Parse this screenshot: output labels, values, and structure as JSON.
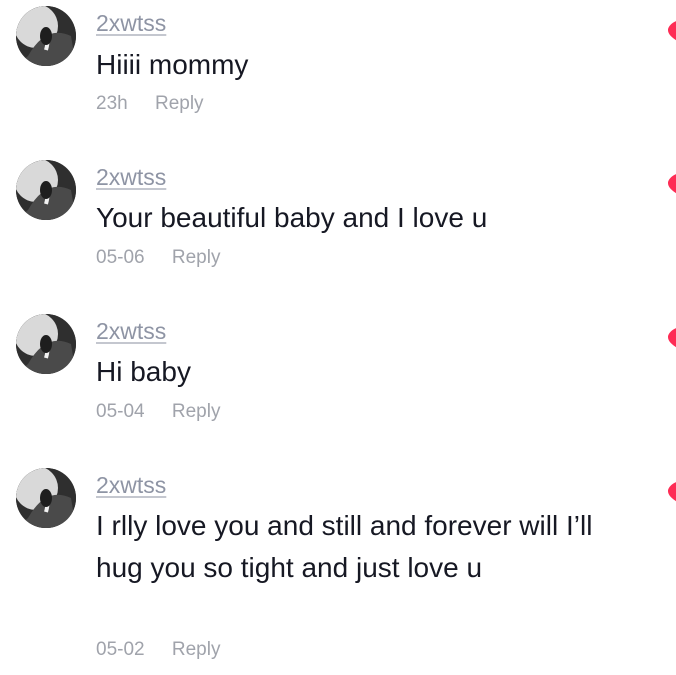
{
  "colors": {
    "username": "#8e94a4",
    "text": "#161823",
    "meta": "#a0a3ab",
    "like": "#fe2c55"
  },
  "icons": {
    "avatar": "avatar-icon",
    "like": "heart-icon"
  },
  "comments": [
    {
      "username": "2xwtss",
      "text": "Hiiii mommy",
      "time": "23h",
      "reply": "Reply"
    },
    {
      "username": "2xwtss",
      "text": "Your beautiful baby and I love u",
      "time": "05-06",
      "reply": "Reply"
    },
    {
      "username": "2xwtss",
      "text": "Hi baby",
      "time": "05-04",
      "reply": "Reply"
    },
    {
      "username": "2xwtss",
      "text": "I rlly love you and still and forever will I’ll hug you so tight and just love u",
      "time": "05-02",
      "reply": "Reply"
    }
  ]
}
